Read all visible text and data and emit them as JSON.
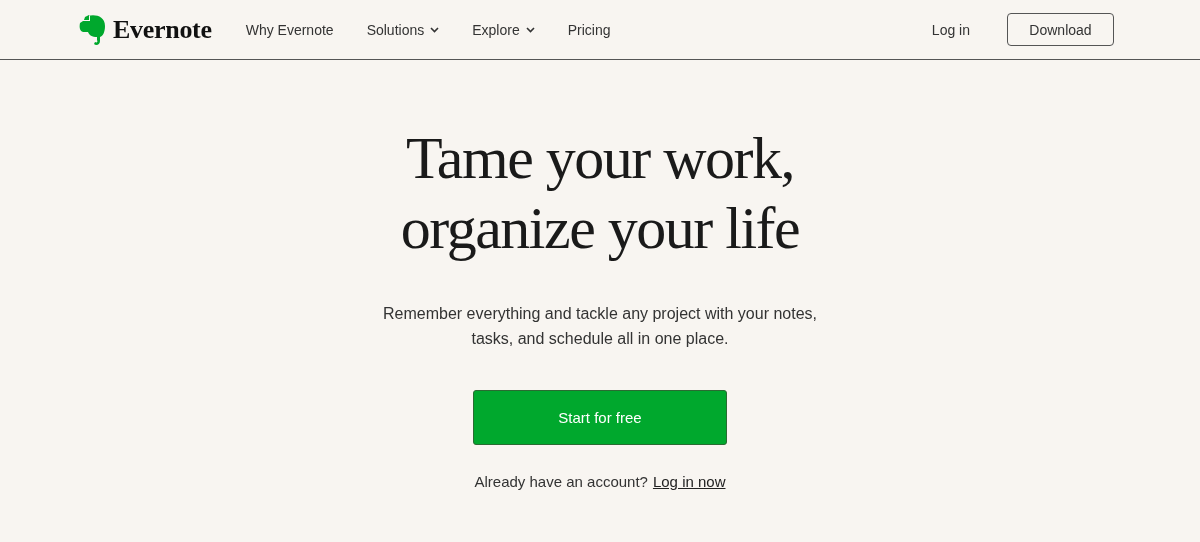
{
  "header": {
    "logo": "Evernote",
    "nav": [
      {
        "label": "Why Evernote",
        "has_menu": false
      },
      {
        "label": "Solutions",
        "has_menu": true
      },
      {
        "label": "Explore",
        "has_menu": true
      },
      {
        "label": "Pricing",
        "has_menu": false
      }
    ],
    "login": "Log in",
    "download": "Download"
  },
  "hero": {
    "headline": [
      "Tame your work,",
      "organize your life"
    ],
    "subtitle": "Remember everything and tackle any project with your notes, tasks, and schedule all in one place.",
    "cta": "Start for free",
    "account_prompt": "Already have an account?",
    "account_link": "Log in now"
  }
}
